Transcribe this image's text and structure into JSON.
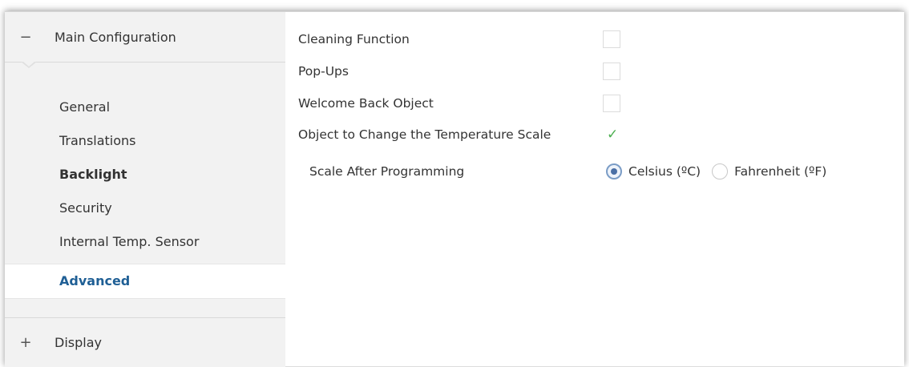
{
  "sidebar": {
    "groups": [
      {
        "expander": "−",
        "label": "Main Configuration"
      },
      {
        "expander": "+",
        "label": "Display"
      }
    ],
    "items": [
      {
        "label": "General"
      },
      {
        "label": "Translations"
      },
      {
        "label": "Backlight"
      },
      {
        "label": "Security"
      },
      {
        "label": "Internal Temp. Sensor"
      },
      {
        "label": "Advanced"
      }
    ]
  },
  "content": {
    "options": [
      {
        "label": "Cleaning Function",
        "checked": false
      },
      {
        "label": "Pop-Ups",
        "checked": false
      },
      {
        "label": "Welcome Back Object",
        "checked": false
      },
      {
        "label": "Object to Change the Temperature Scale",
        "checked": true
      }
    ],
    "check_glyph": "✓",
    "scale": {
      "label": "Scale After Programming",
      "options": [
        {
          "label": "Celsius (ºC)",
          "selected": true
        },
        {
          "label": "Fahrenheit (ºF)",
          "selected": false
        }
      ]
    }
  },
  "colors": {
    "active_item": "#1f5f95",
    "check": "#4caf50",
    "sidebar_bg": "#f2f2f2"
  }
}
